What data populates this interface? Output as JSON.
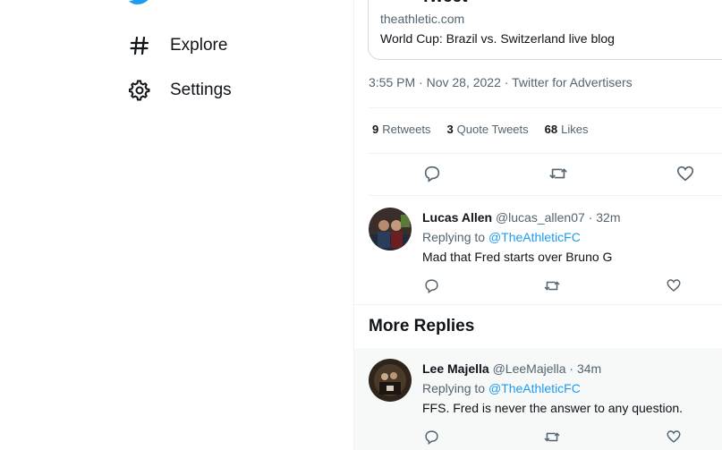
{
  "colors": {
    "accent": "#1d9bf0",
    "text": "#0f1419",
    "muted": "#536471",
    "border": "#cfd9de"
  },
  "nav": {
    "logo_icon": "twitter-bird-icon",
    "items": [
      {
        "label": "Explore",
        "icon": "hashtag-icon"
      },
      {
        "label": "Settings",
        "icon": "gear-icon"
      }
    ]
  },
  "tweet": {
    "header_partial": "Tweet",
    "card": {
      "domain": "theathletic.com",
      "title": "World Cup: Brazil vs. Switzerland live blog"
    },
    "time": "3:55 PM",
    "date": "Nov 28, 2022",
    "source": "Twitter for Advertisers",
    "stats": [
      {
        "count": "9",
        "label": "Retweets"
      },
      {
        "count": "3",
        "label": "Quote Tweets"
      },
      {
        "count": "68",
        "label": "Likes"
      }
    ]
  },
  "replies": [
    {
      "name": "Lucas Allen",
      "handle": "@lucas_allen07",
      "age": "32m",
      "replying_prefix": "Replying to",
      "replying_to": "@TheAthleticFC",
      "text": "Mad that Fred starts over Bruno G"
    }
  ],
  "more_replies": {
    "heading": "More Replies",
    "items": [
      {
        "name": "Lee Majella",
        "handle": "@LeeMajella",
        "age": "34m",
        "replying_prefix": "Replying to",
        "replying_to": "@TheAthleticFC",
        "text": "FFS. Fred is never the answer to any question."
      }
    ]
  },
  "separators": {
    "dot": " · "
  }
}
